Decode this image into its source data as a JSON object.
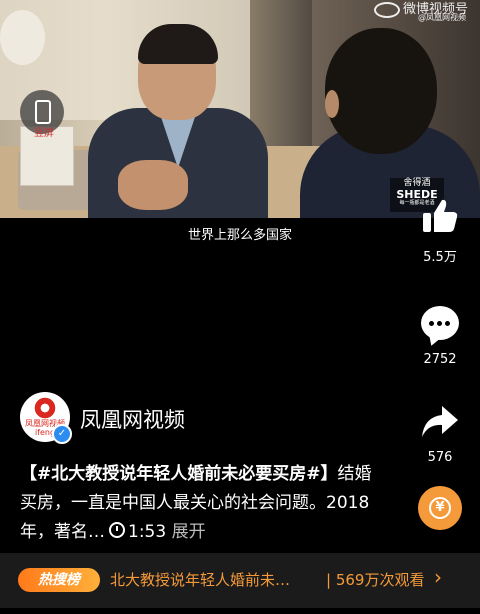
{
  "video": {
    "watermark": "微博视频号",
    "watermark_sub": "@凤凰网视频",
    "subtitle": "世界上那么多国家",
    "rotate_label": "竖屏",
    "brand_top": "舍得酒",
    "brand_main": "SHEDE",
    "brand_sub": "每一瓶都是老酒"
  },
  "actions": {
    "like_count": "5.5万",
    "comment_count": "2752",
    "share_count": "576",
    "coin_symbol": "¥"
  },
  "author": {
    "name": "凤凰网视频",
    "avatar_caption": "凤凰网视频",
    "avatar_sub": "ifeng",
    "verified_symbol": "✓"
  },
  "description": {
    "topic": "【#北大教授说年轻人婚前未必要买房#】",
    "text": "结婚买房，一直是中国人最关心的社会问题。2018年，著名…",
    "duration": "1:53",
    "expand": "展开"
  },
  "hot": {
    "badge": "热搜榜",
    "title": "北大教授说年轻人婚前未…",
    "views": "| 569万次观看",
    "chevron": "›"
  },
  "colors": {
    "accent": "#f59a3a",
    "verified": "#2d8cf0",
    "ifeng_red": "#d8281f"
  }
}
